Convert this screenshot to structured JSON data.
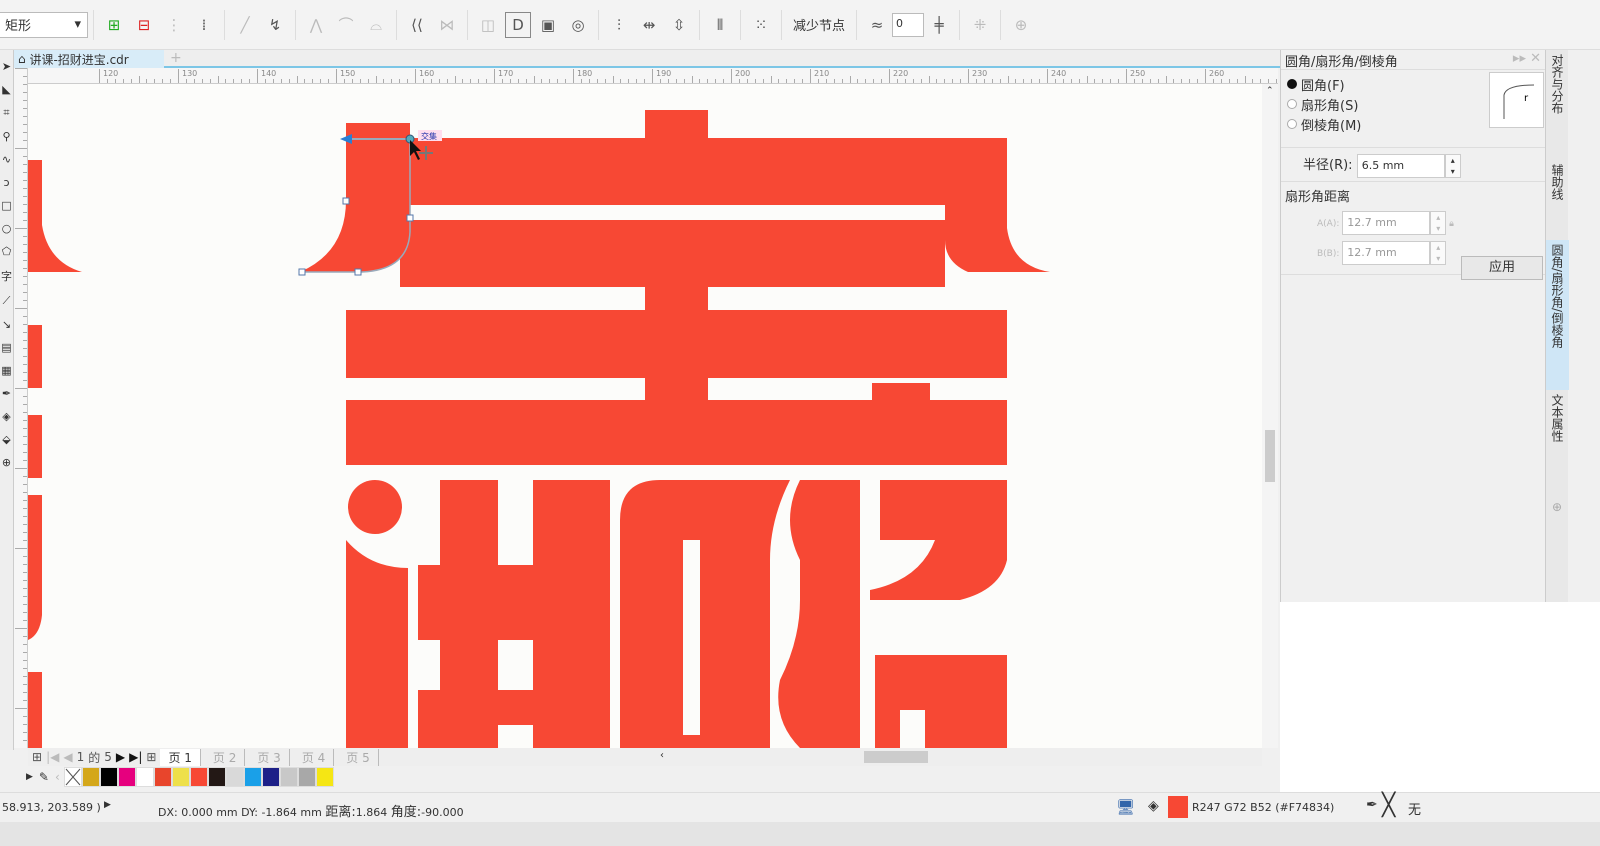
{
  "toolbar": {
    "shape_select": "矩形",
    "reduce_nodes": "减少节点",
    "smoothness": "0"
  },
  "document": {
    "tab": "讲课-招财进宝.cdr",
    "new_tab": "+"
  },
  "ruler": {
    "top_labels": [
      "120",
      "130",
      "140",
      "150",
      "160",
      "170",
      "180",
      "190",
      "200",
      "210",
      "220",
      "230",
      "240",
      "250",
      "260"
    ]
  },
  "canvas": {
    "fill_color": "#F74834",
    "node_tooltip": "交集"
  },
  "panel": {
    "title": "圆角/扇形角/倒棱角",
    "options": [
      {
        "label": "圆角(F)",
        "selected": true
      },
      {
        "label": "扇形角(S)",
        "selected": false
      },
      {
        "label": "倒棱角(M)",
        "selected": false
      }
    ],
    "radius_label": "半径(R):",
    "radius_value": "6.5 mm",
    "distance_heading": "扇形角距离",
    "a_label": "A(A):",
    "a_value": "12.7 mm",
    "b_label": "B(B):",
    "b_value": "12.7 mm",
    "apply": "应用",
    "preview_r": "r"
  },
  "vertical_tabs": [
    "对齐与分布",
    "辅助线",
    "圆角/扇形角/倒棱角",
    "文本属性"
  ],
  "page_nav": {
    "current": "1",
    "of": "的",
    "total": "5",
    "tabs": [
      "页 1",
      "页 2",
      "页 3",
      "页 4",
      "页 5"
    ]
  },
  "palette": [
    "none",
    "#D4A71A",
    "#000000",
    "#E6007E",
    "#FFFFFF",
    "#E8452C",
    "#EEE04A",
    "#F74834",
    "#231815",
    "#D9D9D9",
    "#1AA0E8",
    "#1D2088",
    "#C8C8C8",
    "#A8A8A8",
    "#F5E614"
  ],
  "status": {
    "coords": "58.913, 203.589 )",
    "delta": "DX: 0.000 mm DY: -1.864 mm",
    "distance_label": "距离:",
    "distance": "1.864",
    "angle_label": "角度:",
    "angle": "-90.000",
    "fill_text": "R247 G72 B52 (#F74834)",
    "fill_color": "#F74834",
    "outline_text": "无"
  }
}
